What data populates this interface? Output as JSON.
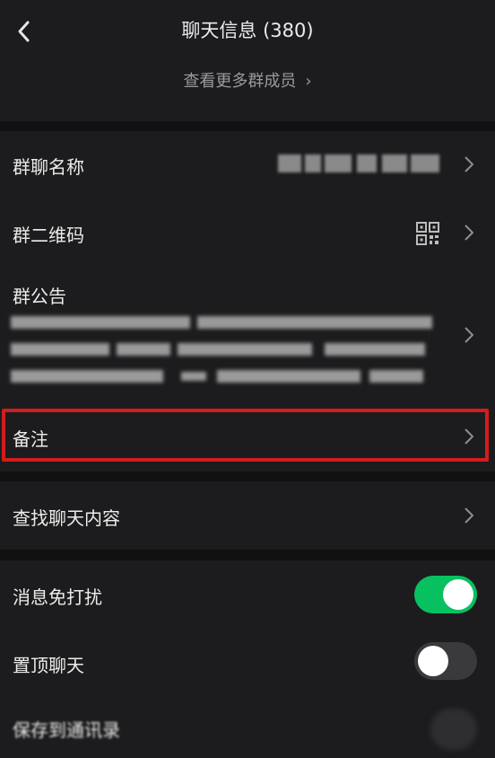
{
  "header": {
    "title": "聊天信息 (380)",
    "more_members": "查看更多群成员",
    "chevron": "›"
  },
  "rows": {
    "group_name": {
      "label": "群聊名称"
    },
    "qr_code": {
      "label": "群二维码"
    },
    "announcement": {
      "label": "群公告"
    },
    "remark": {
      "label": "备注"
    },
    "search_history": {
      "label": "查找聊天内容"
    },
    "mute": {
      "label": "消息免打扰",
      "enabled": true
    },
    "sticky": {
      "label": "置顶聊天",
      "enabled": false
    },
    "save_contacts": {
      "label": "保存到通讯录"
    }
  },
  "colors": {
    "background": "#111111",
    "cell": "#1c1c1e",
    "toggle_on": "#07c160",
    "highlight": "#d31d1d"
  }
}
